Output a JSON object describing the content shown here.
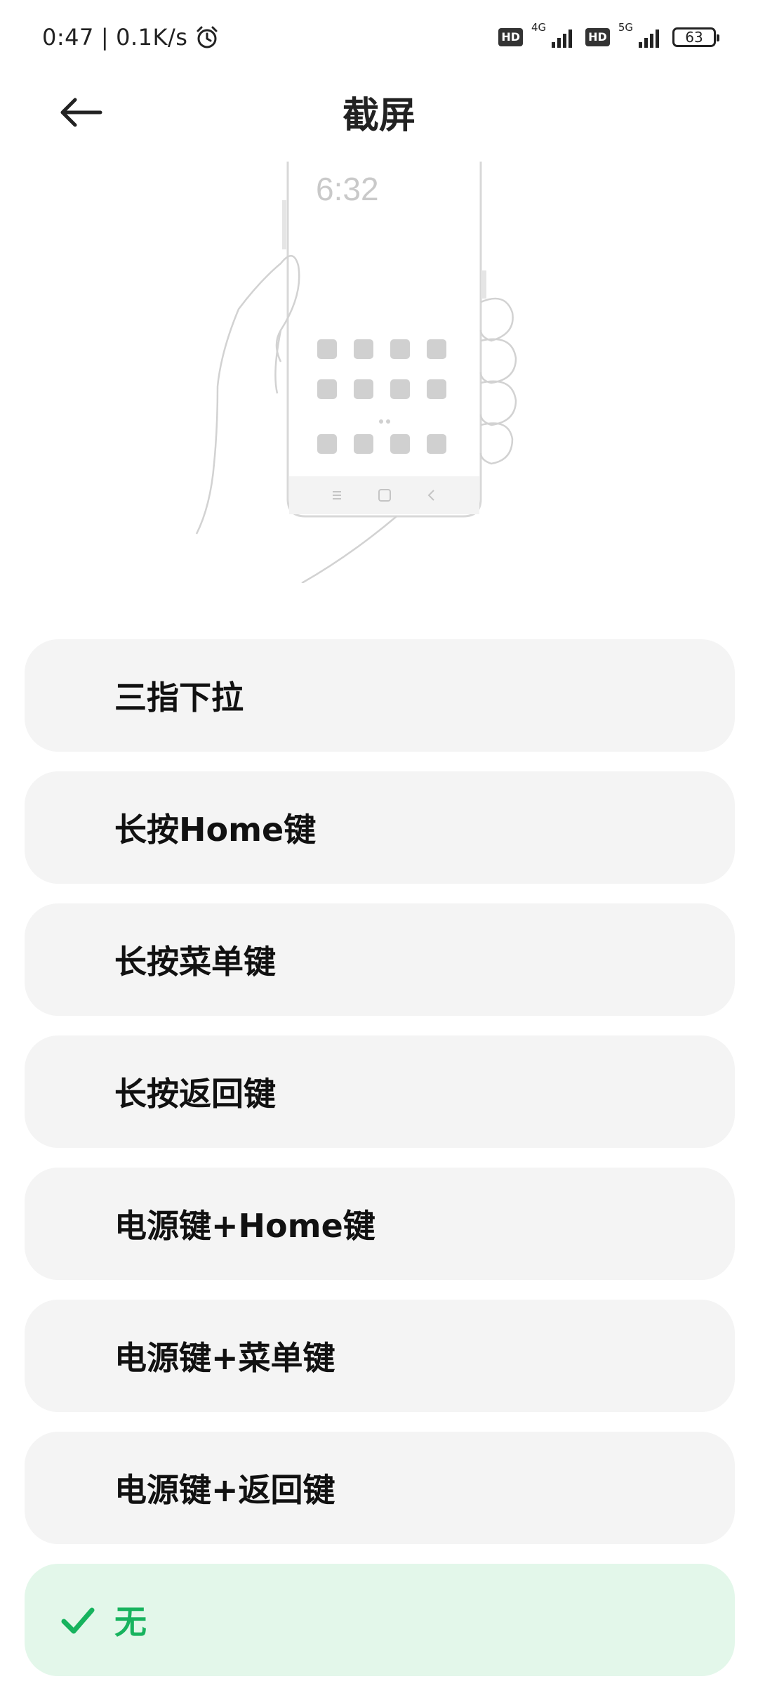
{
  "status_bar": {
    "time": "0:47",
    "separator": "|",
    "speed": "0.1K/s",
    "sim1_badge": "HD",
    "sim1_network": "4G",
    "sim2_badge": "HD",
    "sim2_network": "5G",
    "battery": "63",
    "icons": [
      "alarm-icon",
      "signal-icon",
      "battery-icon"
    ]
  },
  "header": {
    "title": "截屏",
    "back_icon": "arrow-left-icon"
  },
  "illustration": {
    "clock": "6:32"
  },
  "options": [
    {
      "label": "三指下拉",
      "selected": false
    },
    {
      "label": "长按Home键",
      "selected": false
    },
    {
      "label": "长按菜单键",
      "selected": false
    },
    {
      "label": "长按返回键",
      "selected": false
    },
    {
      "label": "电源键+Home键",
      "selected": false
    },
    {
      "label": "电源键+菜单键",
      "selected": false
    },
    {
      "label": "电源键+返回键",
      "selected": false
    },
    {
      "label": "无",
      "selected": true
    }
  ],
  "colors": {
    "accent": "#17b35e",
    "selected_bg": "#e3f7ea",
    "option_bg": "#f4f4f4"
  }
}
